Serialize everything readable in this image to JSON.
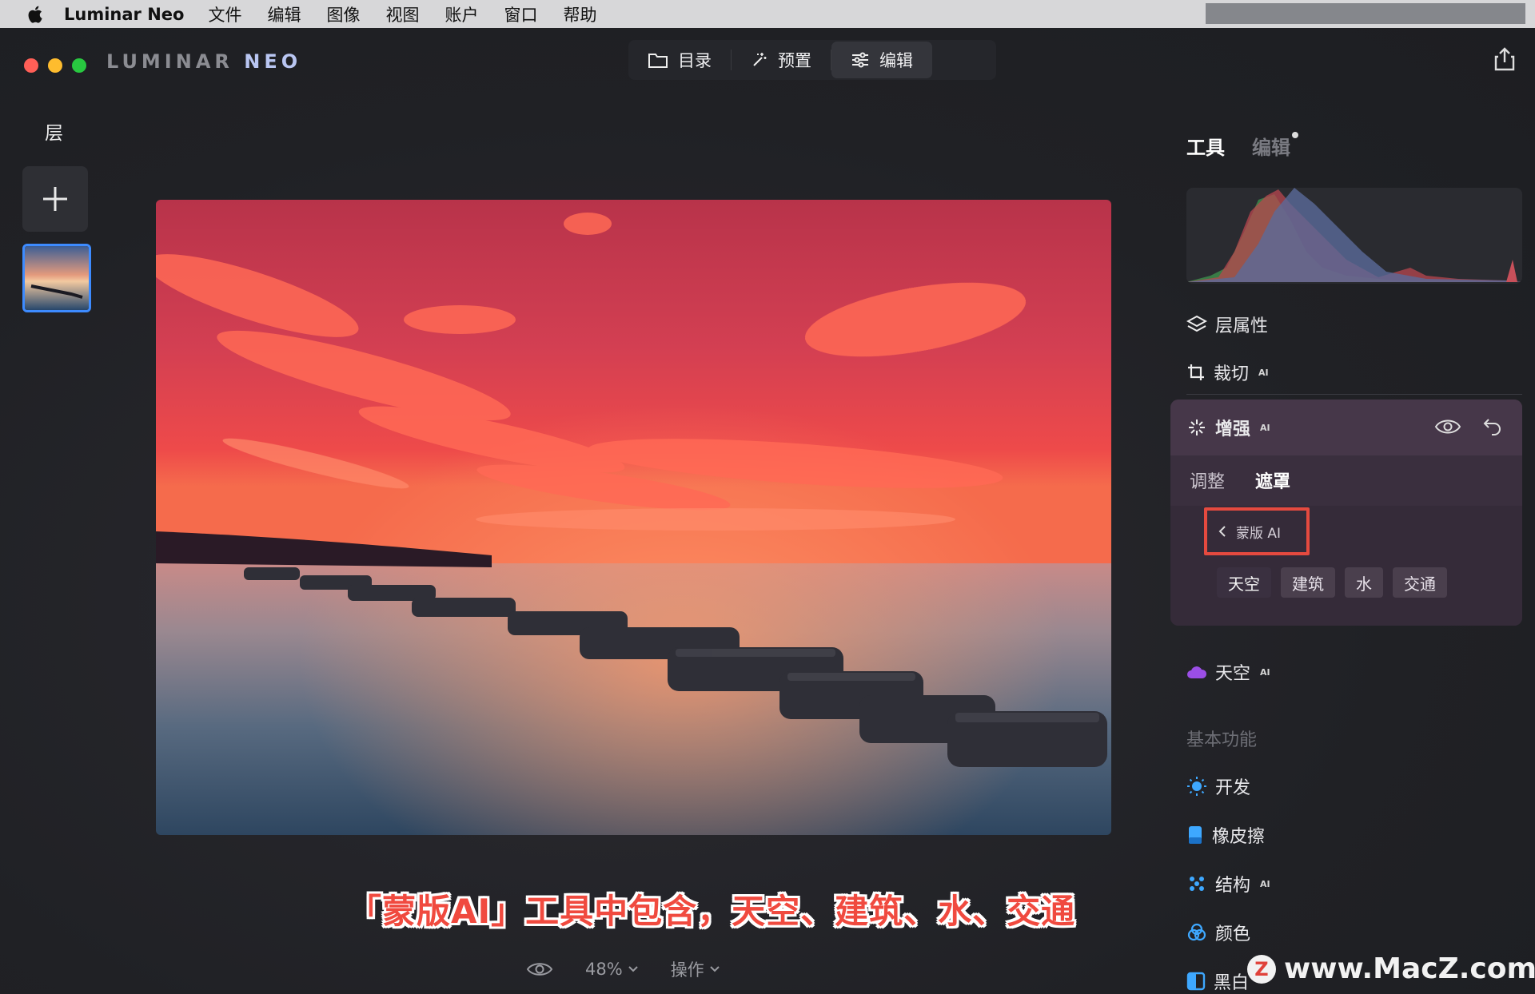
{
  "menubar": {
    "app_name": "Luminar Neo",
    "items": [
      "文件",
      "编辑",
      "图像",
      "视图",
      "账户",
      "窗口",
      "帮助"
    ]
  },
  "header": {
    "logo_left": "LUMINAR ",
    "logo_right": "NEO",
    "nav": [
      {
        "label": "目录",
        "icon": "folder-icon"
      },
      {
        "label": "预置",
        "icon": "magic-wand-icon"
      },
      {
        "label": "编辑",
        "icon": "sliders-icon",
        "active": true
      }
    ]
  },
  "layers": {
    "title": "层"
  },
  "canvas": {
    "caption": "「蒙版AI」工具中包含，天空、建筑、水、交通",
    "zoom": "48%",
    "actions_label": "操作"
  },
  "right_panel": {
    "tabs": {
      "tools": "工具",
      "edits": "编辑"
    },
    "layer_properties": "层属性",
    "crop": "裁切",
    "ai_badge": "AI",
    "enhance": {
      "title": "增强",
      "subtabs": {
        "adjust": "调整",
        "mask": "遮罩"
      },
      "mask_ai_label": "蒙版 AI",
      "chips": [
        "天空",
        "建筑",
        "水",
        "交通"
      ]
    },
    "sky": "天空",
    "basic_section": "基本功能",
    "tools": [
      {
        "label": "开发",
        "icon": "sun-icon",
        "ai": false
      },
      {
        "label": "橡皮擦",
        "icon": "eraser-icon",
        "ai": false
      },
      {
        "label": "结构",
        "icon": "structure-icon",
        "ai": true
      },
      {
        "label": "颜色",
        "icon": "color-circles-icon",
        "ai": false
      },
      {
        "label": "黑白",
        "icon": "bw-icon",
        "ai": false
      }
    ]
  },
  "watermark": {
    "badge": "Z",
    "text": "www.MacZ.com"
  },
  "colors": {
    "accent_blue": "#3d8bff",
    "highlight_red": "#e54a3f",
    "enhance_card": "#3a2f3e"
  }
}
